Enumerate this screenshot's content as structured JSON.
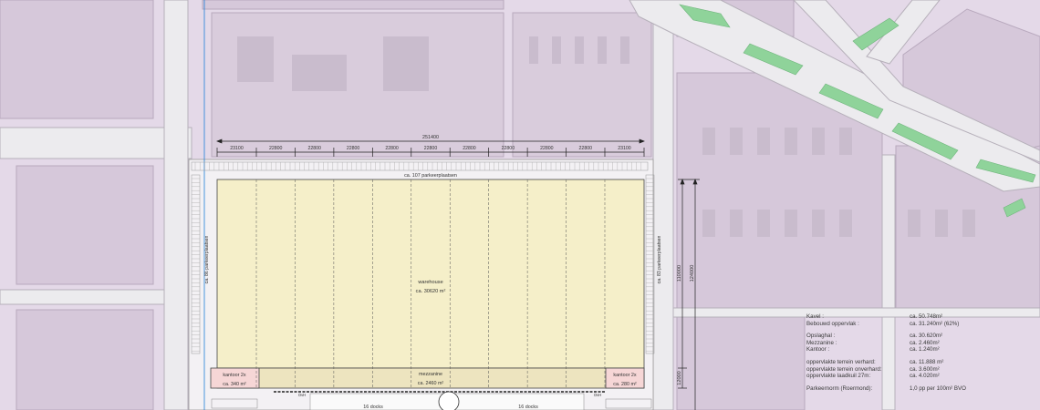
{
  "dimensions": {
    "total_width": "251400",
    "bays": [
      "23100",
      "22800",
      "22800",
      "22800",
      "22800",
      "22800",
      "22800",
      "22800",
      "22800",
      "22800",
      "23100"
    ],
    "depth_warehouse": "110000",
    "depth_total": "124000",
    "depth_mezzanine": "12000"
  },
  "parking": {
    "top": "ca. 107 parkeerplaatsen",
    "left": "ca. 86 parkeerplaatsen",
    "right": "ca. 83 parkeerplaatsen"
  },
  "warehouse": {
    "name": "warehouse",
    "area": "ca. 30620 m²"
  },
  "mezzanine": {
    "name": "mezzanine",
    "area": "ca. 2460 m²"
  },
  "offices": {
    "left": {
      "name": "kantoor 2x",
      "area": "ca. 340 m²"
    },
    "right": {
      "name": "kantoor 2x",
      "area": "ca. 280 m²"
    }
  },
  "docks": {
    "left": "16 docks",
    "right": "16 docks",
    "ovh_left": "OvH",
    "ovh_right": "OvH"
  },
  "legend": [
    [
      {
        "label": "Kavel :",
        "value": "ca. 50.748m²"
      },
      {
        "label": "Bebouwd oppervlak :",
        "value": "ca. 31.240m² (62%)"
      }
    ],
    [
      {
        "label": "Opslaghal :",
        "value": "ca. 30.620m²"
      },
      {
        "label": "Mezzanine :",
        "value": "ca.  2.460m²"
      },
      {
        "label": "Kantoor :",
        "value": "ca.  1.240m²"
      }
    ],
    [
      {
        "label": "oppervlakte terrein verhard:",
        "value": "ca. 11.888 m²"
      },
      {
        "label": "oppervlakte terrein onverhard:",
        "value": "ca.  3.600m²"
      },
      {
        "label": "oppervlakte laadkuil 27m:",
        "value": "ca.  4.020m²"
      }
    ],
    [
      {
        "label": "Parkeernorm (Roermond):",
        "value": "1,0 pp per 100m² BVO"
      }
    ]
  ],
  "colors": {
    "background": "#e4d9e8",
    "road": "#ecebee",
    "road_edge": "#b6b0ba",
    "block": "#d6c8da",
    "green": "#8fd39a",
    "site": "#f3f1f4",
    "warehouse": "#f5efc9",
    "mezzanine": "#ede4bf",
    "office": "#f6d6d6",
    "lines": "#222222"
  }
}
